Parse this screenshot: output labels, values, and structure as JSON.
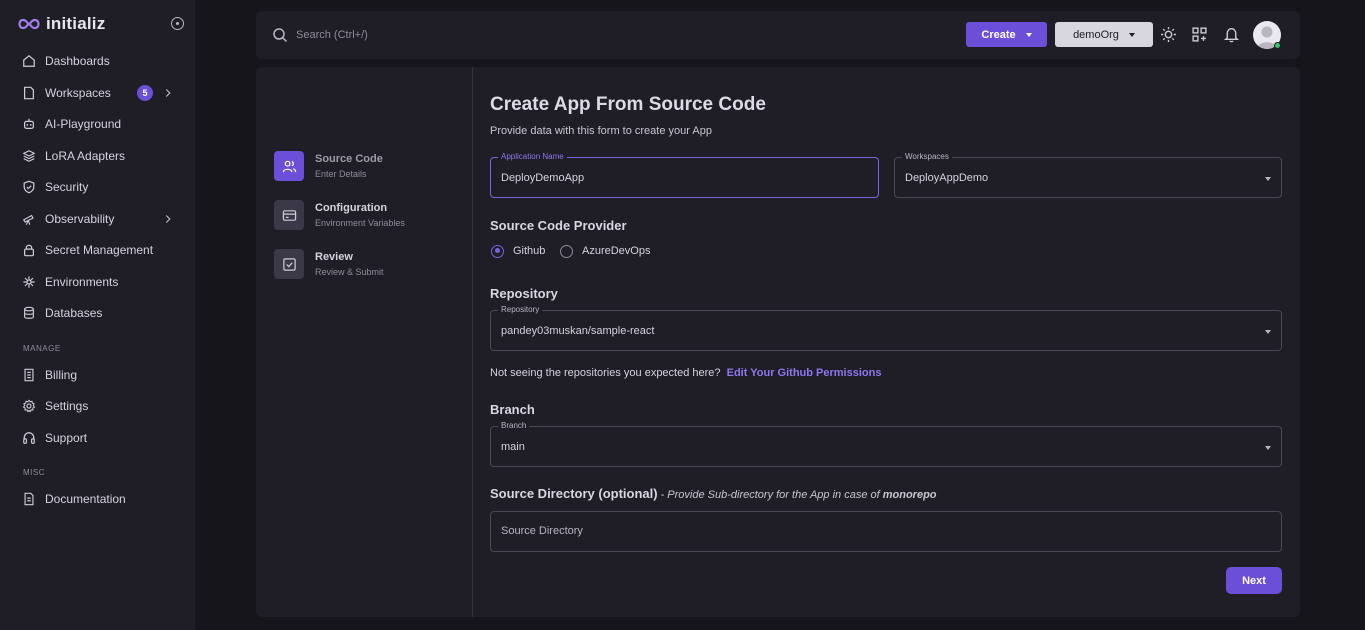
{
  "brand": {
    "name": "initializ"
  },
  "sidebar": {
    "items": [
      {
        "label": "Dashboards",
        "icon": "home-icon"
      },
      {
        "label": "Workspaces",
        "icon": "file-icon",
        "badge": "5"
      },
      {
        "label": "AI-Playground",
        "icon": "robot-icon"
      },
      {
        "label": "LoRA Adapters",
        "icon": "layers-icon"
      },
      {
        "label": "Security",
        "icon": "shield-icon"
      },
      {
        "label": "Observability",
        "icon": "telescope-icon"
      },
      {
        "label": "Secret Management",
        "icon": "lock-icon"
      },
      {
        "label": "Environments",
        "icon": "snowflake-icon"
      },
      {
        "label": "Databases",
        "icon": "database-icon"
      }
    ],
    "manage_label": "MANAGE",
    "manage_items": [
      {
        "label": "Billing",
        "icon": "receipt-icon"
      },
      {
        "label": "Settings",
        "icon": "gear-icon"
      },
      {
        "label": "Support",
        "icon": "headphones-icon"
      }
    ],
    "misc_label": "MISC",
    "misc_items": [
      {
        "label": "Documentation",
        "icon": "document-icon"
      }
    ]
  },
  "topbar": {
    "search_placeholder": "Search (Ctrl+/)",
    "create_label": "Create",
    "org_label": "demoOrg"
  },
  "steps": [
    {
      "title": "Source Code",
      "subtitle": "Enter Details"
    },
    {
      "title": "Configuration",
      "subtitle": "Environment Variables"
    },
    {
      "title": "Review",
      "subtitle": "Review & Submit"
    }
  ],
  "form": {
    "title": "Create App From Source Code",
    "subtitle": "Provide data with this form to create your App",
    "app_name": {
      "label": "Application Name",
      "value": "DeployDemoApp"
    },
    "workspace": {
      "label": "Workspaces",
      "value": "DeployAppDemo"
    },
    "provider_heading": "Source Code Provider",
    "providers": [
      "Github",
      "AzureDevOps"
    ],
    "selected_provider": "Github",
    "repo_heading": "Repository",
    "repository": {
      "label": "Repository",
      "value": "pandey03muskan/sample-react"
    },
    "repo_hint": "Not seeing the repositories you expected here?",
    "repo_hint_link": "Edit Your Github Permissions",
    "branch_heading": "Branch",
    "branch": {
      "label": "Branch",
      "value": "main"
    },
    "srcdir_heading": "Source Directory (optional)",
    "srcdir_note_prefix": "- Provide Sub-directory for the App in case of",
    "srcdir_note_bold": "monorepo",
    "srcdir_placeholder": "Source Directory",
    "next_label": "Next"
  },
  "colors": {
    "accent": "#6c4fd8",
    "background": "#17151c",
    "surface": "#1f1d26"
  }
}
